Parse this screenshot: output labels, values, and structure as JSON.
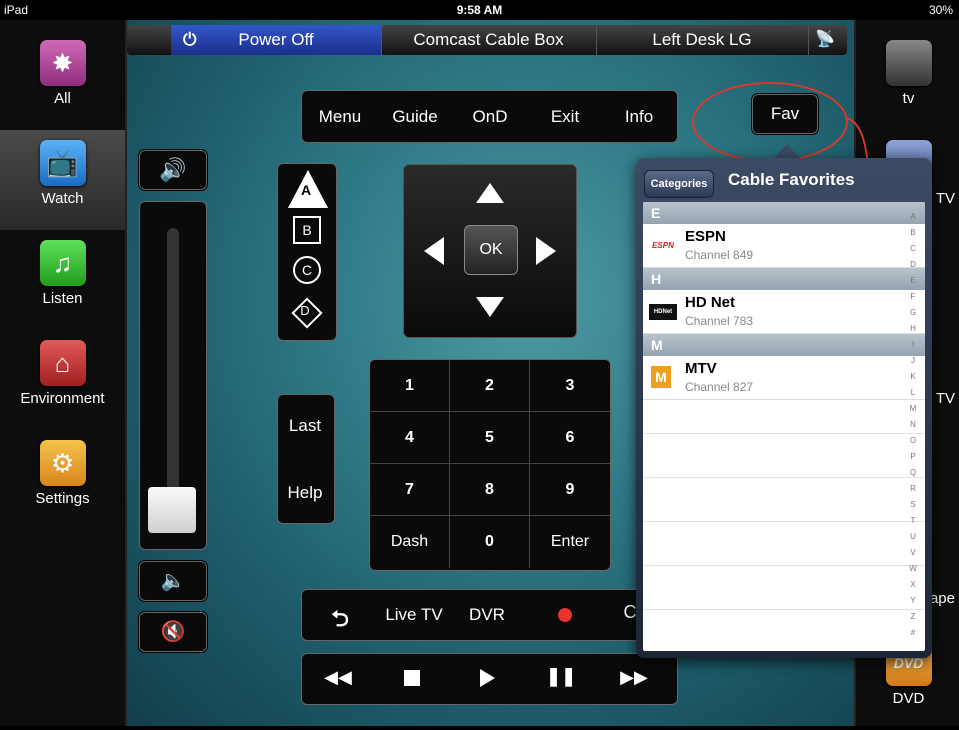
{
  "status": {
    "device": "iPad",
    "time": "9:58 AM",
    "battery": "30%"
  },
  "sidebar": [
    {
      "label": "All",
      "icon": "compass-icon",
      "color": "#b24a9c"
    },
    {
      "label": "Watch",
      "icon": "tv-icon",
      "color": "#2f8fe0",
      "selected": true
    },
    {
      "label": "Listen",
      "icon": "music-note-icon",
      "color": "#38c93a"
    },
    {
      "label": "Environment",
      "icon": "house-thermometer-icon",
      "color": "#c93a3a"
    },
    {
      "label": "Settings",
      "icon": "gears-icon",
      "color": "#e8a62a"
    }
  ],
  "topbar": {
    "power": "Power Off",
    "device1": "Comcast Cable Box",
    "device2": "Left Desk LG"
  },
  "menu": [
    "Menu",
    "Guide",
    "OnD",
    "Exit",
    "Info"
  ],
  "fav": "Fav",
  "abcd": [
    "A",
    "B",
    "C",
    "D"
  ],
  "dpad": {
    "ok": "OK"
  },
  "last_help": [
    "Last",
    "Help"
  ],
  "numpad": [
    "1",
    "2",
    "3",
    "4",
    "5",
    "6",
    "7",
    "8",
    "9",
    "Dash",
    "0",
    "Enter"
  ],
  "transport1": {
    "livetv": "Live TV",
    "dvr": "DVR"
  },
  "rightbar": [
    {
      "label": "tv",
      "icon": "apple-tv-icon"
    },
    {
      "label": "TV",
      "icon": "tv-icon"
    },
    {
      "label": "TV",
      "icon": "tv-icon"
    },
    {
      "label": "ape",
      "icon": "tape-icon"
    },
    {
      "label": "DVD",
      "icon": "dvd-icon"
    }
  ],
  "popover": {
    "back": "Categories",
    "title": "Cable Favorites",
    "sections": [
      {
        "header": "E",
        "items": [
          {
            "name": "ESPN",
            "sub": "Channel 849",
            "logo": "ESPN"
          }
        ]
      },
      {
        "header": "H",
        "items": [
          {
            "name": "HD Net",
            "sub": "Channel 783",
            "logo": "HDNet"
          }
        ]
      },
      {
        "header": "M",
        "items": [
          {
            "name": "MTV",
            "sub": "Channel 827",
            "logo": "M"
          }
        ]
      }
    ],
    "index": [
      "A",
      "B",
      "C",
      "D",
      "E",
      "F",
      "G",
      "H",
      "I",
      "J",
      "K",
      "L",
      "M",
      "N",
      "O",
      "P",
      "Q",
      "R",
      "S",
      "T",
      "U",
      "V",
      "W",
      "X",
      "Y",
      "Z",
      "#"
    ]
  },
  "colors": {
    "accent_red": "#d63a2a",
    "record": "#e8322a"
  }
}
